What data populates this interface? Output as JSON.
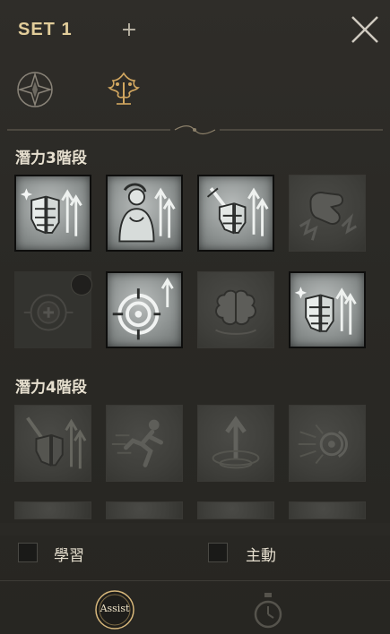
{
  "header": {
    "set_label": "SET 1",
    "add_label": "+"
  },
  "sections": {
    "stage3_title": "潛力3階段",
    "stage4_title": "潛力4階段"
  },
  "stage3_tiles": [
    {
      "icon": "armor-up-icon",
      "state": "on"
    },
    {
      "icon": "warrior-up-icon",
      "state": "on"
    },
    {
      "icon": "sword-armor-up-icon",
      "state": "on"
    },
    {
      "icon": "fist-shatter-icon",
      "state": "off"
    },
    {
      "icon": "heal-cross-icon",
      "state": "dim"
    },
    {
      "icon": "crosshair-up-icon",
      "state": "on"
    },
    {
      "icon": "brain-icon",
      "state": "off"
    },
    {
      "icon": "armor-up-icon",
      "state": "on"
    }
  ],
  "stage4_tiles": [
    {
      "icon": "sword-armor-up-icon",
      "state": "off"
    },
    {
      "icon": "sprint-icon",
      "state": "off"
    },
    {
      "icon": "arrow-ring-icon",
      "state": "off"
    },
    {
      "icon": "energy-burst-icon",
      "state": "off"
    }
  ],
  "options": {
    "learn_label": "學習",
    "active_label": "主動"
  },
  "footer": {
    "assist_label": "Assist"
  },
  "colors": {
    "accent": "#e2cd9a",
    "background": "#2b2a26"
  }
}
